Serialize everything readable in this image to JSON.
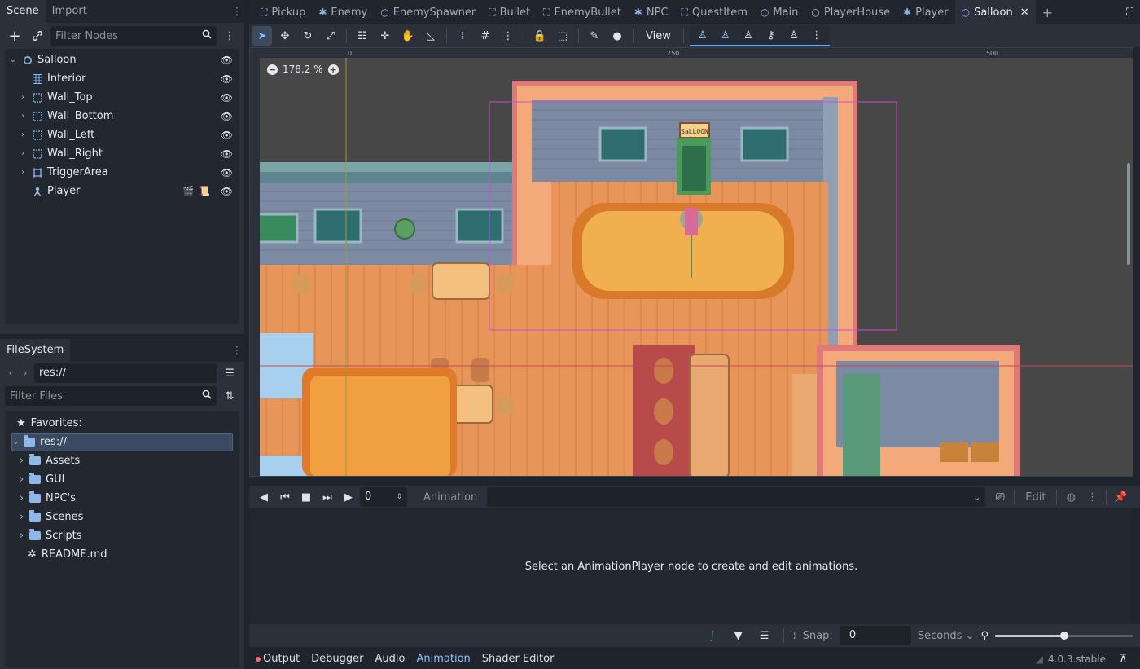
{
  "scene_dock": {
    "tabs": [
      "Scene",
      "Import"
    ],
    "filter_placeholder": "Filter Nodes",
    "nodes": [
      {
        "label": "Salloon",
        "icon": "node2d-icon"
      },
      {
        "label": "Interior",
        "icon": "tilemap-icon"
      },
      {
        "label": "Wall_Top",
        "icon": "staticbody-icon"
      },
      {
        "label": "Wall_Bottom",
        "icon": "staticbody-icon"
      },
      {
        "label": "Wall_Left",
        "icon": "staticbody-icon"
      },
      {
        "label": "Wall_Right",
        "icon": "staticbody-icon"
      },
      {
        "label": "TriggerArea",
        "icon": "area2d-icon"
      },
      {
        "label": "Player",
        "icon": "characterbody-icon"
      }
    ]
  },
  "filesystem_dock": {
    "tab": "FileSystem",
    "path": "res://",
    "filter_placeholder": "Filter Files",
    "items": [
      {
        "label": "Favorites:",
        "type": "favorites"
      },
      {
        "label": "res://",
        "type": "root"
      },
      {
        "label": "Assets",
        "type": "folder"
      },
      {
        "label": "GUI",
        "type": "folder"
      },
      {
        "label": "NPC's",
        "type": "folder"
      },
      {
        "label": "Scenes",
        "type": "folder"
      },
      {
        "label": "Scripts",
        "type": "folder"
      },
      {
        "label": "README.md",
        "type": "file"
      }
    ]
  },
  "scene_tabs": [
    {
      "label": "Pickup",
      "active": false
    },
    {
      "label": "Enemy",
      "active": false
    },
    {
      "label": "EnemySpawner",
      "active": false
    },
    {
      "label": "Bullet",
      "active": false
    },
    {
      "label": "EnemyBullet",
      "active": false
    },
    {
      "label": "NPC",
      "active": false
    },
    {
      "label": "QuestItem",
      "active": false
    },
    {
      "label": "Main",
      "active": false
    },
    {
      "label": "PlayerHouse",
      "active": false
    },
    {
      "label": "Player",
      "active": false
    },
    {
      "label": "Salloon",
      "active": true
    }
  ],
  "toolbar": {
    "view_label": "View"
  },
  "viewport": {
    "zoom": "178.2 %",
    "ruler_ticks": [
      "0",
      "250",
      "500"
    ],
    "sign_text": "SaLLOON"
  },
  "animation": {
    "time_value": "0",
    "animation_label": "Animation",
    "edit_label": "Edit",
    "empty_message": "Select an AnimationPlayer node to create and edit animations.",
    "snap_label": "Snap:",
    "snap_value": "0",
    "unit": "Seconds",
    "zoom_level": 0.5
  },
  "bottom_tabs": [
    "Output",
    "Debugger",
    "Audio",
    "Animation",
    "Shader Editor"
  ],
  "active_bottom_tab": "Animation",
  "version": "4.0.3.stable",
  "colors": {
    "accent": "#8fc1ff",
    "folder": "#8fb8e8",
    "floor": "#e8955a",
    "wall": "#7c8aa4"
  }
}
